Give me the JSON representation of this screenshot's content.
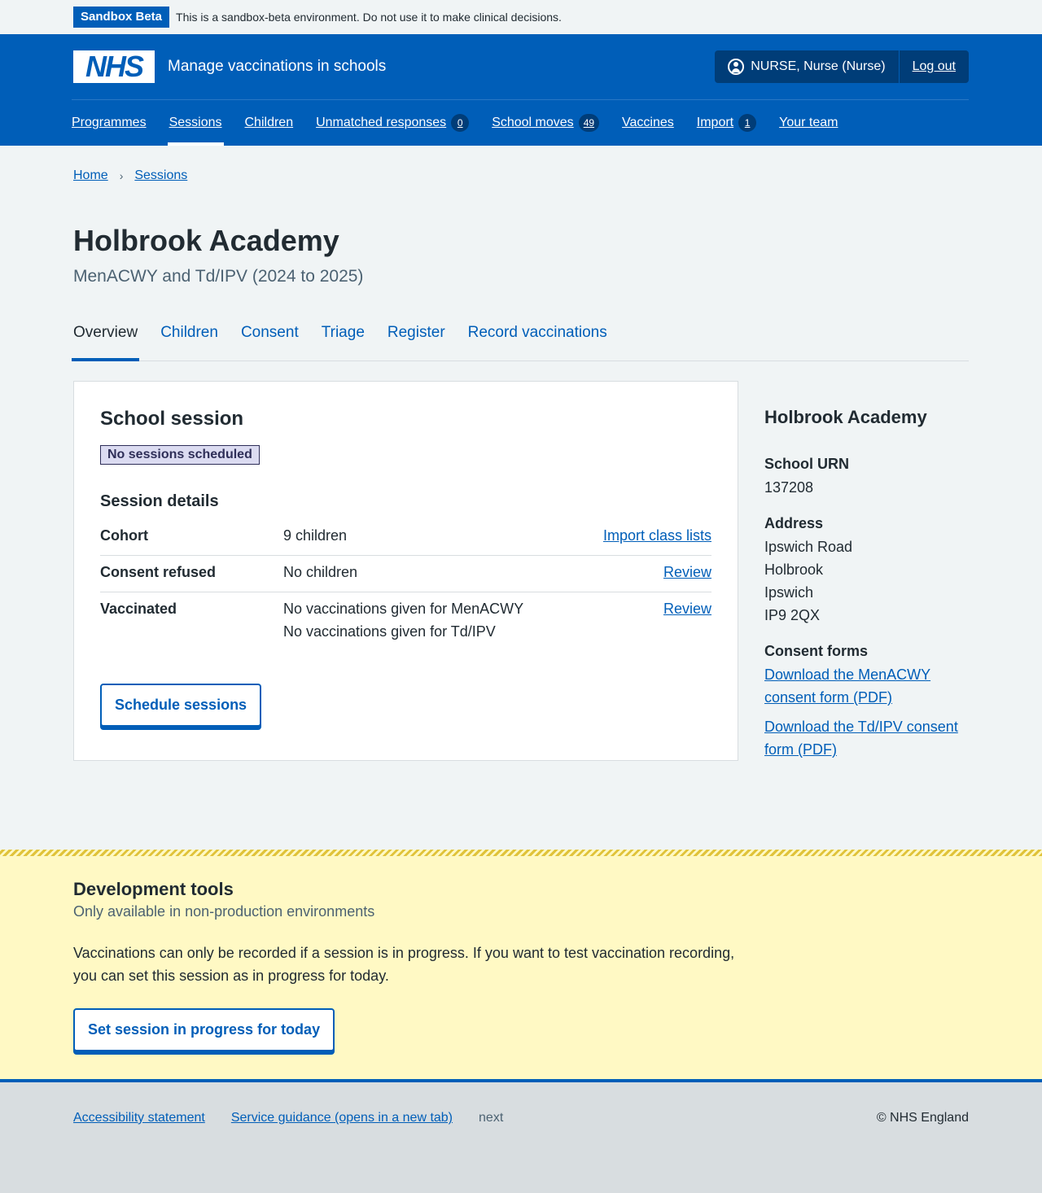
{
  "sandbox": {
    "tag": "Sandbox Beta",
    "message": "This is a sandbox-beta environment. Do not use it to make clinical decisions."
  },
  "header": {
    "logo_text": "NHS",
    "service_name": "Manage vaccinations in schools",
    "user_label": "NURSE, Nurse (Nurse)",
    "logout_label": "Log out",
    "nav": [
      {
        "label": "Programmes"
      },
      {
        "label": "Sessions",
        "active": true
      },
      {
        "label": "Children"
      },
      {
        "label": "Unmatched responses",
        "count": "0"
      },
      {
        "label": "School moves",
        "count": "49"
      },
      {
        "label": "Vaccines"
      },
      {
        "label": "Import",
        "count": "1"
      },
      {
        "label": "Your team"
      }
    ]
  },
  "breadcrumb": [
    {
      "label": "Home"
    },
    {
      "label": "Sessions"
    }
  ],
  "page": {
    "title": "Holbrook Academy",
    "caption": "MenACWY and Td/IPV (2024 to 2025)"
  },
  "tabs": [
    {
      "label": "Overview",
      "active": true
    },
    {
      "label": "Children"
    },
    {
      "label": "Consent"
    },
    {
      "label": "Triage"
    },
    {
      "label": "Register"
    },
    {
      "label": "Record vaccinations"
    }
  ],
  "card": {
    "title": "School session",
    "status": "No sessions scheduled",
    "details_heading": "Session details",
    "rows": [
      {
        "key": "Cohort",
        "values": [
          "9 children"
        ],
        "action": "Import class lists"
      },
      {
        "key": "Consent refused",
        "values": [
          "No children"
        ],
        "action": "Review"
      },
      {
        "key": "Vaccinated",
        "values": [
          "No vaccinations given for MenACWY",
          "No vaccinations given for Td/IPV"
        ],
        "action": "Review"
      }
    ],
    "button": "Schedule sessions"
  },
  "sidebar": {
    "title": "Holbrook Academy",
    "urn_label": "School URN",
    "urn": "137208",
    "address_label": "Address",
    "address": [
      "Ipswich Road",
      "Holbrook",
      "Ipswich",
      "IP9 2QX"
    ],
    "consent_label": "Consent forms",
    "consent_links": [
      "Download the MenACWY consent form (PDF)",
      "Download the Td/IPV consent form (PDF)"
    ]
  },
  "dev_tools": {
    "title": "Development tools",
    "subtitle": "Only available in non-production environments",
    "description": "Vaccinations can only be recorded if a session is in progress. If you want to test vaccination recording, you can set this session as in progress for today.",
    "button": "Set session in progress for today"
  },
  "footer": {
    "accessibility": "Accessibility statement",
    "guidance": "Service guidance (opens in a new tab)",
    "version": "next",
    "copyright": "© NHS England"
  },
  "colors": {
    "brand_blue": "#005eb8",
    "dark_blue": "#003d78",
    "dev_yellow": "#fff9c4"
  }
}
